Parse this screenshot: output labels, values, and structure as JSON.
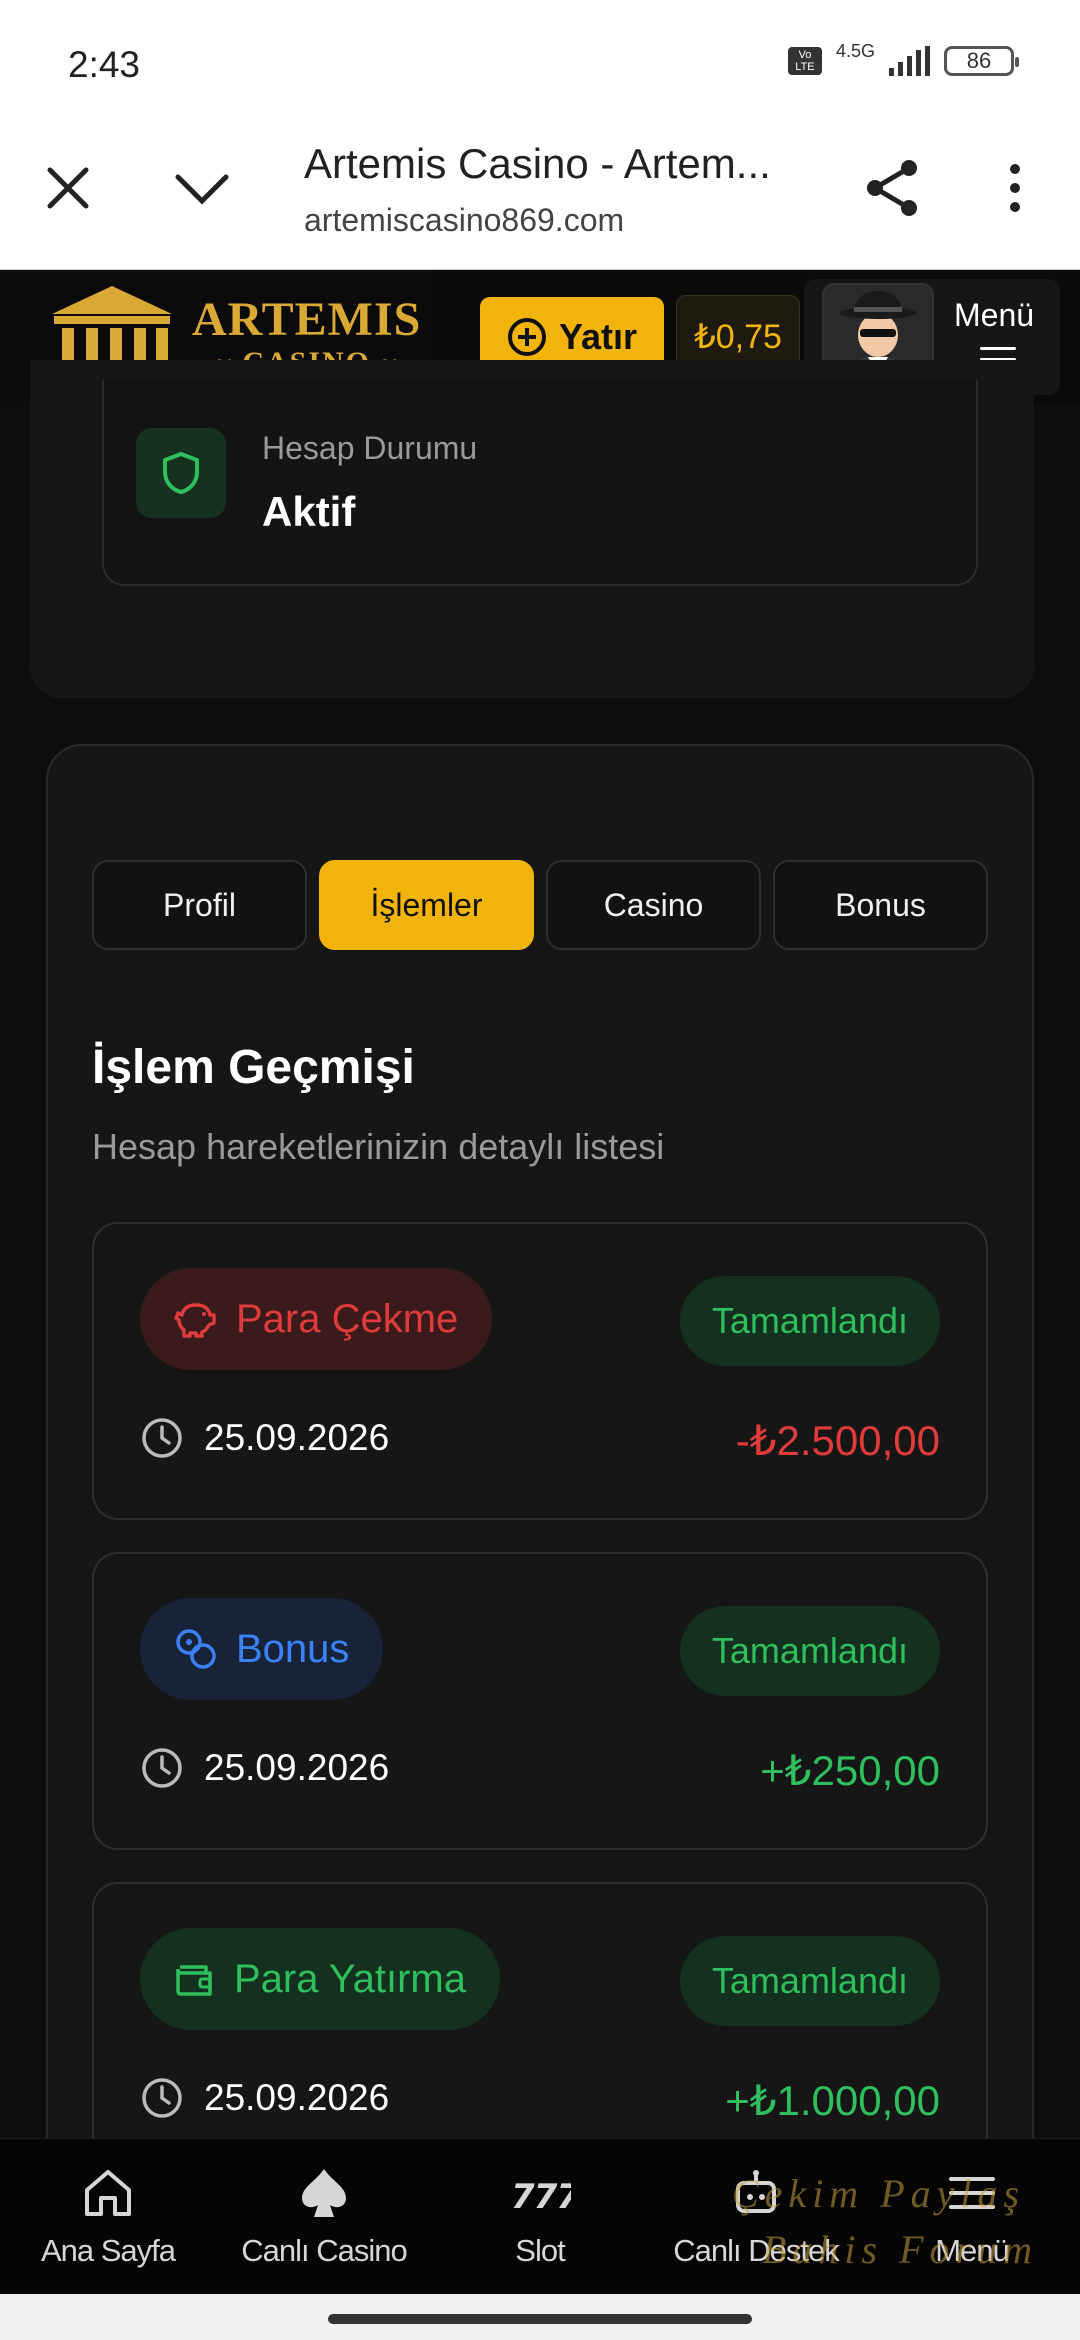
{
  "status_bar": {
    "time": "2:43",
    "volte": "VoLTE",
    "network": "4.5G",
    "battery": "86"
  },
  "browser": {
    "title": "Artemis Casino - Artem...",
    "url": "artemiscasino869.com"
  },
  "header": {
    "logo_main": "ARTEMIS",
    "logo_sub": "CASINO",
    "deposit_label": "Yatır",
    "balance": "₺0,75",
    "menu_label": "Menü"
  },
  "account_status": {
    "label": "Hesap Durumu",
    "value": "Aktif"
  },
  "tabs": [
    {
      "label": "Profil",
      "active": false
    },
    {
      "label": "İşlemler",
      "active": true
    },
    {
      "label": "Casino",
      "active": false
    },
    {
      "label": "Bonus",
      "active": false
    }
  ],
  "history": {
    "title": "İşlem Geçmişi",
    "subtitle": "Hesap hareketlerinizin detaylı listesi",
    "transactions": [
      {
        "type": "Para Çekme",
        "status": "Tamamlandı",
        "date": "25.09.2026",
        "amount": "-₺2.500,00",
        "icon": "piggy-bank-icon",
        "color": "#e03b3b"
      },
      {
        "type": "Bonus",
        "status": "Tamamlandı",
        "date": "25.09.2026",
        "amount": "+₺250,00",
        "icon": "coins-icon",
        "color": "#3b82f6"
      },
      {
        "type": "Para Yatırma",
        "status": "Tamamlandı",
        "date": "25.09.2026",
        "amount": "+₺1.000,00",
        "icon": "wallet-icon",
        "color": "#2fbf5c"
      }
    ]
  },
  "bottom_nav": [
    {
      "label": "Ana Sayfa",
      "icon": "home-icon"
    },
    {
      "label": "Canlı Casino",
      "icon": "spade-icon"
    },
    {
      "label": "Slot",
      "icon": "slot-777-icon"
    },
    {
      "label": "Canlı Destek",
      "icon": "support-bot-icon"
    },
    {
      "label": "Menü",
      "icon": "menu-icon"
    }
  ],
  "watermark": {
    "line1": "Çekim Paylaş",
    "line2": "Bahis Forum"
  },
  "colors": {
    "accent": "#f2b40b",
    "success": "#2fbf5c",
    "danger": "#e03b3b",
    "info": "#3b82f6"
  }
}
